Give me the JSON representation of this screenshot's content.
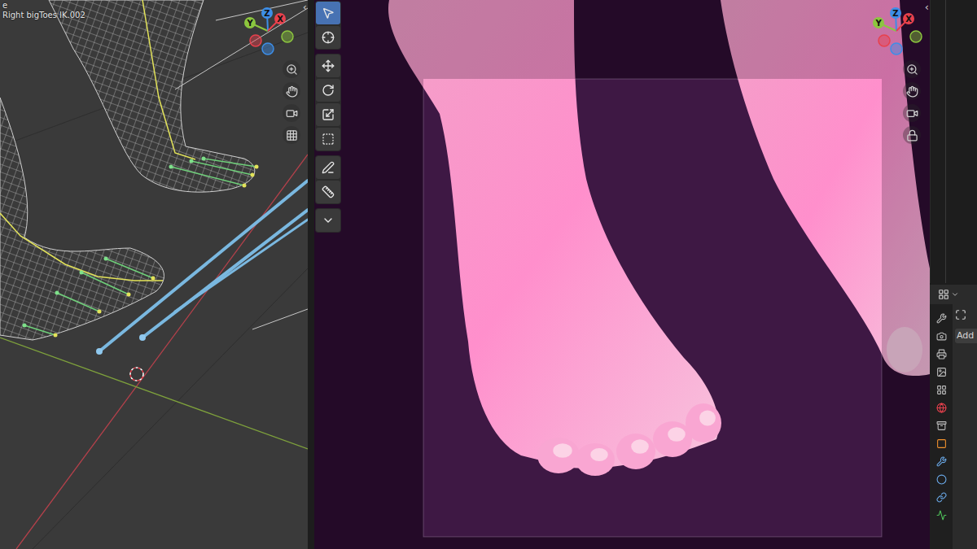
{
  "left_viewport": {
    "header_text": "e",
    "active_bone": "Right bigToes IK.002",
    "sidebar_toggle": "‹",
    "gizmo": [
      {
        "label": "Y",
        "color": "#8cc63f"
      },
      {
        "label": "Z",
        "color": "#3d8ee8"
      },
      {
        "label": "X",
        "color": "#e8414d"
      }
    ],
    "nav": [
      {
        "kind": "zoom"
      },
      {
        "kind": "hand"
      },
      {
        "kind": "camera"
      },
      {
        "kind": "grid"
      }
    ]
  },
  "right_viewport": {
    "sidebar_toggle": "‹",
    "gizmo": [
      {
        "label": "Y",
        "color": "#8cc63f"
      },
      {
        "label": "Z",
        "color": "#3d8ee8"
      },
      {
        "label": "X",
        "color": "#e8414d"
      }
    ],
    "nav": [
      {
        "kind": "zoom"
      },
      {
        "kind": "hand"
      },
      {
        "kind": "camera"
      },
      {
        "kind": "lock"
      }
    ]
  },
  "toolbar": [
    [
      {
        "kind": "select",
        "selected": true
      },
      {
        "kind": "cursor",
        "selected": false
      }
    ],
    [
      {
        "kind": "move",
        "selected": false
      },
      {
        "kind": "rotate",
        "selected": false
      },
      {
        "kind": "scale",
        "selected": false
      },
      {
        "kind": "transform",
        "selected": false
      }
    ],
    [
      {
        "kind": "annotate",
        "selected": false
      },
      {
        "kind": "measure",
        "selected": false
      }
    ],
    [
      {
        "kind": "extrude",
        "selected": false
      }
    ]
  ],
  "properties": {
    "add_label": "Add",
    "tabs": [
      {
        "kind": "tool",
        "color": "#bdbdbd",
        "selected": false
      },
      {
        "kind": "render",
        "color": "#bdbdbd",
        "selected": false
      },
      {
        "kind": "output",
        "color": "#bdbdbd",
        "selected": false
      },
      {
        "kind": "view",
        "color": "#bdbdbd",
        "selected": false
      },
      {
        "kind": "scene",
        "color": "#bdbdbd",
        "selected": false
      },
      {
        "kind": "world",
        "color": "#e8414d",
        "selected": false
      },
      {
        "kind": "collection",
        "color": "#bdbdbd",
        "selected": false
      },
      {
        "kind": "object",
        "color": "#f0912d",
        "selected": false
      },
      {
        "kind": "modifier",
        "color": "#6aa9e8",
        "selected": false
      },
      {
        "kind": "physics",
        "color": "#6aa9e8",
        "selected": false
      },
      {
        "kind": "constraint",
        "color": "#6aa9e8",
        "selected": false
      },
      {
        "kind": "data",
        "color": "#4fc25a",
        "selected": false
      }
    ]
  }
}
